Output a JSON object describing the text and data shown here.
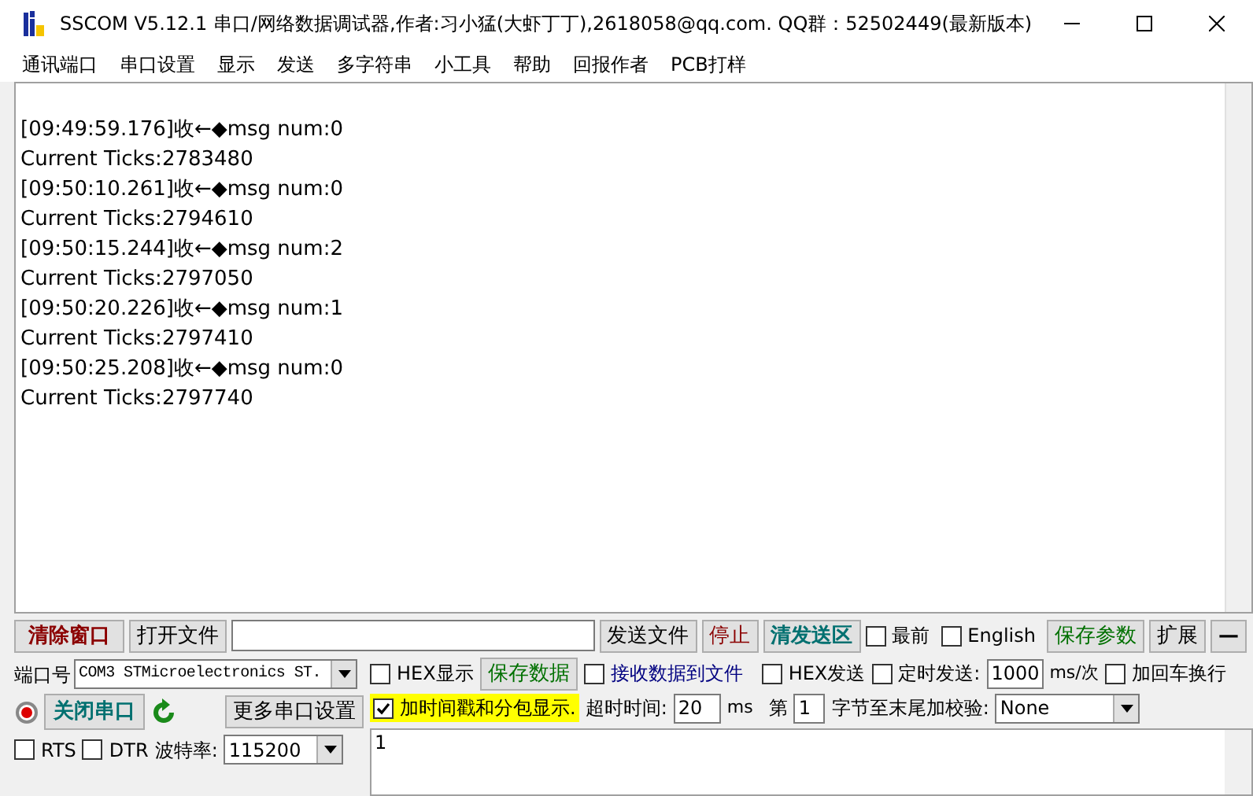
{
  "window": {
    "title": "SSCOM V5.12.1 串口/网络数据调试器,作者:习小猛(大虾丁丁),2618058@qq.com. QQ群：52502449(最新版本)"
  },
  "menu": [
    "通讯端口",
    "串口设置",
    "显示",
    "发送",
    "多字符串",
    "小工具",
    "帮助",
    "回报作者",
    "PCB打样"
  ],
  "receive_lines": [
    "[09:49:59.176]收←◆msg num:0",
    "Current Ticks:2783480",
    "[09:50:10.261]收←◆msg num:0",
    "Current Ticks:2794610",
    "[09:50:15.244]收←◆msg num:2",
    "Current Ticks:2797050",
    "[09:50:20.226]收←◆msg num:1",
    "Current Ticks:2797410",
    "[09:50:25.208]收←◆msg num:0",
    "Current Ticks:2797740"
  ],
  "toolbar": {
    "clear_button": "清除窗口",
    "open_file_button": "打开文件",
    "send_file_button": "发送文件",
    "stop_button": "停止",
    "clear_send_button": "清发送区",
    "topmost": {
      "label": "最前",
      "checked": false
    },
    "english": {
      "label": "English",
      "checked": false
    },
    "save_params_button": "保存参数",
    "expand_button": "扩展",
    "minimize_button": "—"
  },
  "port": {
    "label": "端口号",
    "value": "COM3 STMicroelectronics ST.",
    "open_button": "关闭串口",
    "more_settings_button": "更多串口设置",
    "rts": {
      "label": "RTS",
      "checked": false
    },
    "dtr": {
      "label": "DTR",
      "checked": false
    },
    "baud_label": "波特率:",
    "baud_value": "115200"
  },
  "receive_options": {
    "hex_display": {
      "label": "HEX显示",
      "checked": false
    },
    "save_data_button": "保存数据",
    "to_file": {
      "label": "接收数据到文件",
      "checked": false
    },
    "timestamp": {
      "label": "加时间戳和分包显示.",
      "checked": true
    },
    "timeout_label": "超时时间:",
    "timeout_value": "20",
    "timeout_unit": "ms"
  },
  "send_options": {
    "hex_send": {
      "label": "HEX发送",
      "checked": false
    },
    "timed_send": {
      "label": "定时发送:",
      "checked": false
    },
    "interval_value": "1000",
    "interval_unit": "ms/次",
    "add_newline": {
      "label": "加回车换行",
      "checked": false
    },
    "byte_prefix": "第",
    "byte_value": "1",
    "checksum_label": "字节至末尾加校验:",
    "checksum_value": "None"
  },
  "send_text": "1"
}
